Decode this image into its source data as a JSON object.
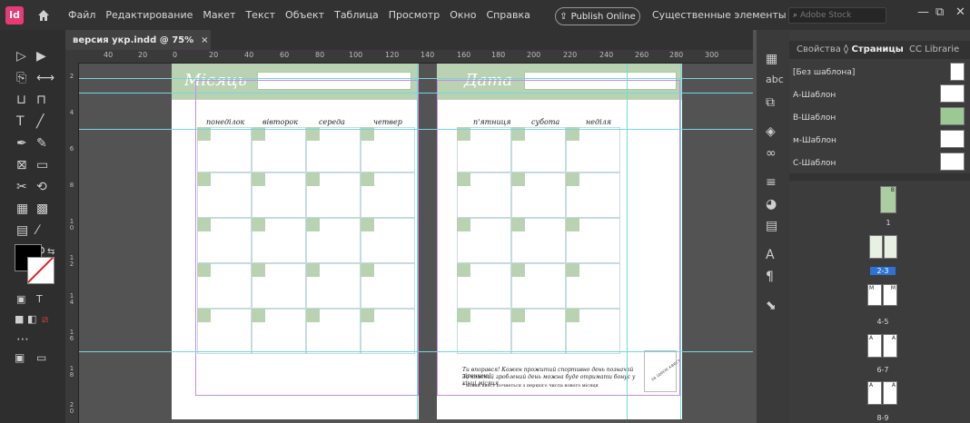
{
  "app": {
    "logo": "Id",
    "menu": [
      "Файл",
      "Редактирование",
      "Макет",
      "Текст",
      "Объект",
      "Таблица",
      "Просмотр",
      "Окно",
      "Справка"
    ],
    "publish_label": "Publish Online",
    "workspace_label": "Существенные элементы",
    "stock_placeholder": "Adobe Stock"
  },
  "document": {
    "tab_title": "версия укр.indd @ 75%",
    "tab_close": "×"
  },
  "ruler": {
    "h_labels": [
      "40",
      "20",
      "0",
      "20",
      "40",
      "60",
      "80",
      "100",
      "120",
      "140",
      "160",
      "180",
      "200",
      "220",
      "240",
      "260",
      "280",
      "300"
    ],
    "v_labels": [
      "2",
      "4",
      "6",
      "8",
      "1 0",
      "1 2",
      "1 4",
      "1 6",
      "1 8",
      "2 0"
    ]
  },
  "spread": {
    "left_title": "Місяць",
    "right_title": "Дата",
    "left_days": [
      "понеділок",
      "вівторок",
      "середа",
      "четвер"
    ],
    "right_days": [
      "п'ятниця",
      "субота",
      "неділя"
    ],
    "note_line1": "Ти впорався! Кожен прожитий спортивно день позначай зірочкою!",
    "note_line2": "За кожний зроблений день можна буде отримати бонус у кінці місяця",
    "note_line3": "* новий квест почнеться з першого числа нового місяця",
    "stamp_text": "за ідеєю квест"
  },
  "panel": {
    "tabs": [
      "Свойства",
      "Страницы",
      "CC Librarie"
    ],
    "active_tab": "Страницы",
    "masters": [
      "[Без шаблона]",
      "А-Шаблон",
      "В-Шаблон",
      "м-Шаблон",
      "С-Шаблон"
    ],
    "page_labels": [
      "1",
      "2-3",
      "4-5",
      "6-7",
      "8-9"
    ],
    "page_letters": [
      "B",
      "M",
      "M",
      "A",
      "A",
      "A",
      "A"
    ]
  },
  "colors": {
    "accent_green": "#b9d3b2",
    "guide_cyan": "#74d7e0",
    "margin_purple": "#c88ae6",
    "app_bg": "#535353"
  }
}
